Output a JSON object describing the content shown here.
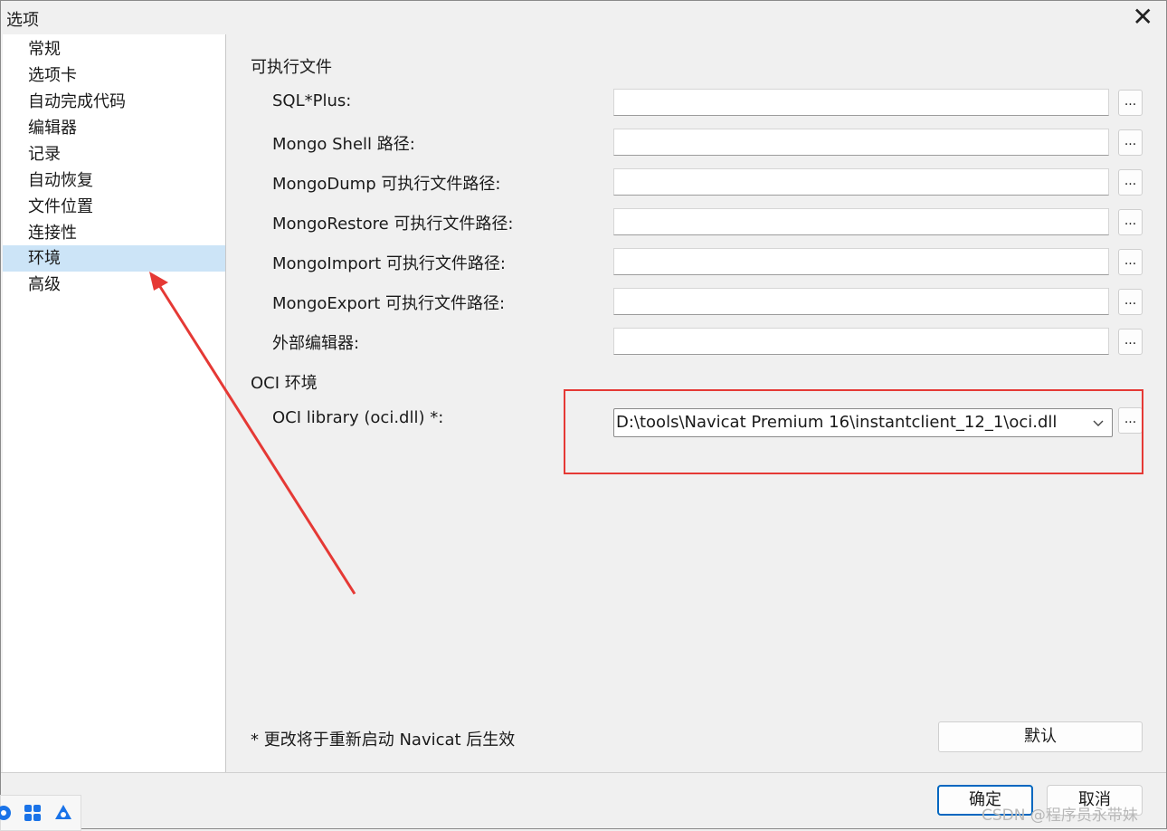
{
  "window": {
    "title": "选项",
    "close_glyph": "✕"
  },
  "sidebar": {
    "selected": "环境",
    "items": [
      {
        "label": "常规"
      },
      {
        "label": "选项卡"
      },
      {
        "label": "自动完成代码"
      },
      {
        "label": "编辑器"
      },
      {
        "label": "记录"
      },
      {
        "label": "自动恢复"
      },
      {
        "label": "文件位置"
      },
      {
        "label": "连接性"
      },
      {
        "label": "环境"
      },
      {
        "label": "高级"
      }
    ]
  },
  "main": {
    "executables_section": "可执行文件",
    "fields": [
      {
        "label": "SQL*Plus:",
        "value": ""
      },
      {
        "label": "Mongo Shell 路径:",
        "value": ""
      },
      {
        "label": "MongoDump 可执行文件路径:",
        "value": ""
      },
      {
        "label": "MongoRestore 可执行文件路径:",
        "value": ""
      },
      {
        "label": "MongoImport 可执行文件路径:",
        "value": ""
      },
      {
        "label": "MongoExport 可执行文件路径:",
        "value": ""
      },
      {
        "label": "外部编辑器:",
        "value": ""
      }
    ],
    "browse_label": "...",
    "oci_section": "OCI 环境",
    "oci_label": "OCI library (oci.dll) *:",
    "oci_value": "D:\\tools\\Navicat Premium 16\\instantclient_12_1\\oci.dll",
    "note": "* 更改将于重新启动 Navicat 后生效",
    "default_button": "默认"
  },
  "footer": {
    "ok": "确定",
    "cancel": "取消"
  },
  "watermark": "CSDN @程序员永带妹",
  "colors": {
    "accent": "#0067c0",
    "selection": "#cce4f7",
    "annotation": "#e53935"
  },
  "icons": {
    "close": "close-icon",
    "dropdown": "chevron-down-icon",
    "annotation": "red-arrow-annotation"
  }
}
